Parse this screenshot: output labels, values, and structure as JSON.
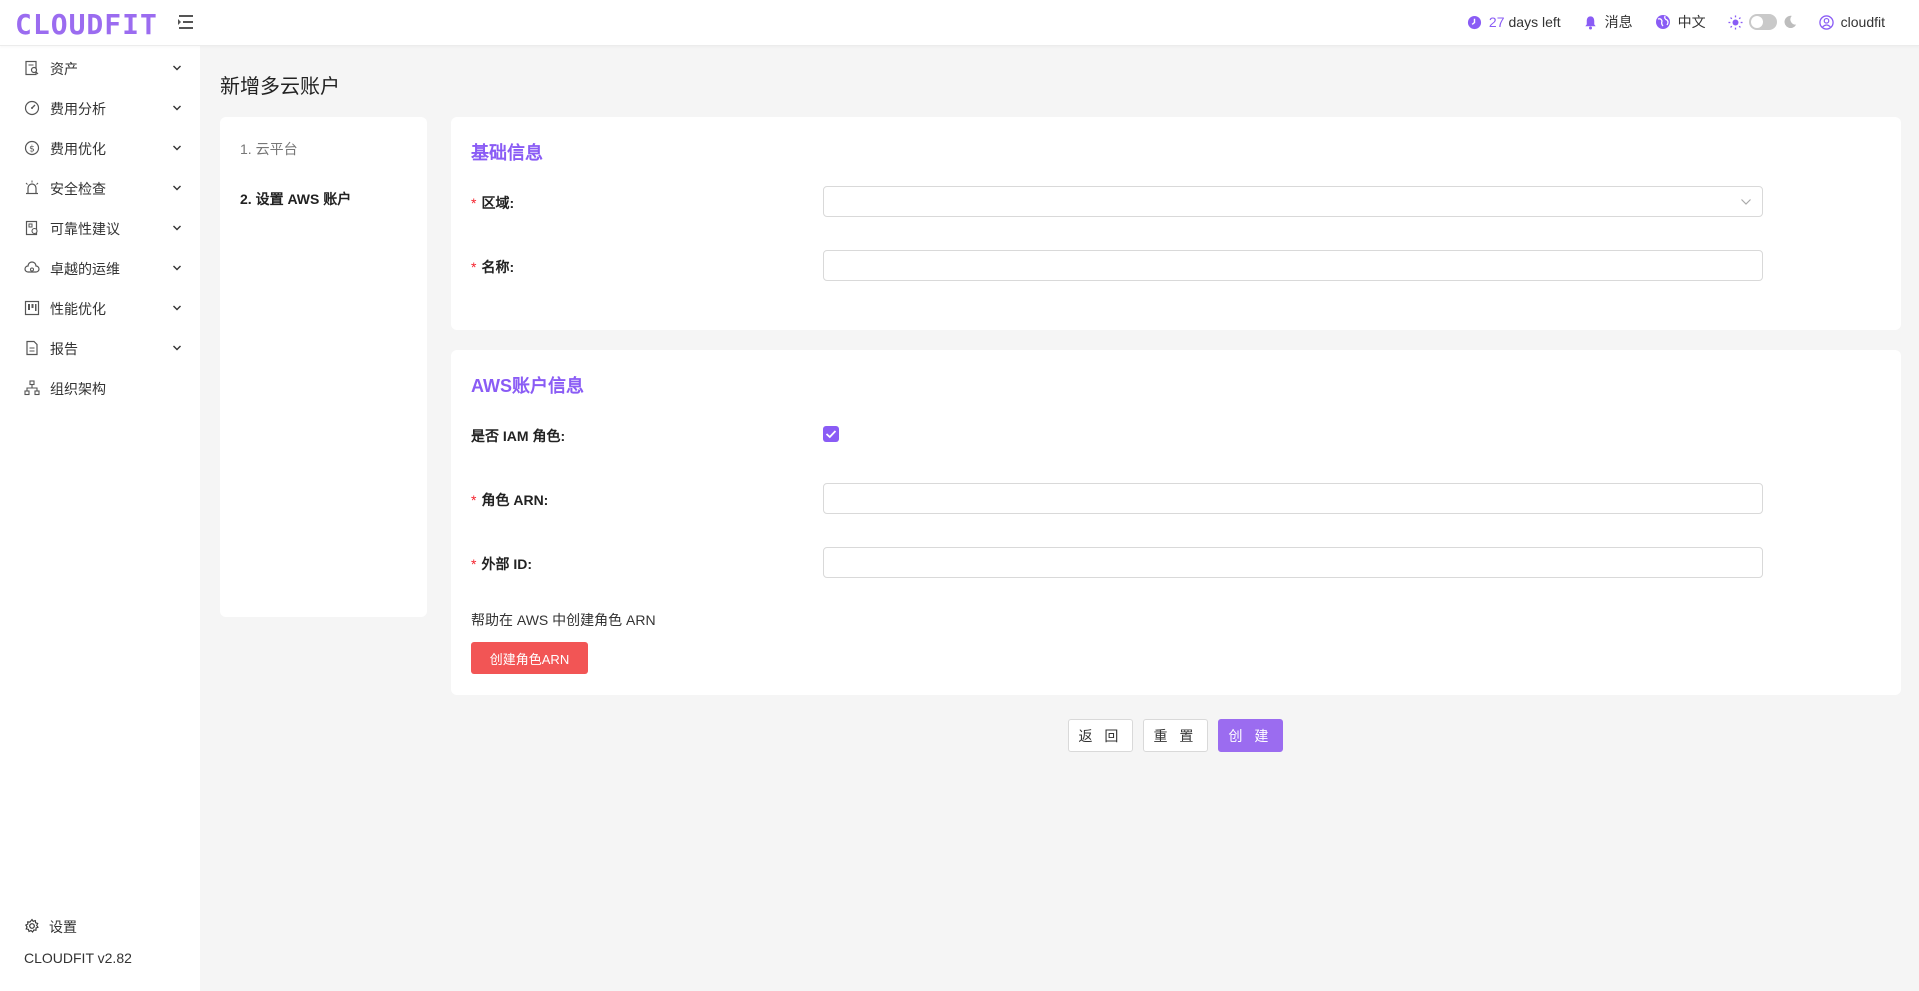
{
  "brand": {
    "logo": "CLOUDFIT",
    "accent_color": "#9b6cf0"
  },
  "header": {
    "trial_days": "27",
    "trial_suffix": "days left",
    "messages": "消息",
    "language": "中文",
    "username": "cloudfit"
  },
  "sidebar": {
    "items": [
      {
        "label": "资产",
        "icon": "asset-search-icon"
      },
      {
        "label": "费用分析",
        "icon": "dashboard-gauge-icon"
      },
      {
        "label": "费用优化",
        "icon": "dollar-circle-icon"
      },
      {
        "label": "安全检查",
        "icon": "alarm-light-icon"
      },
      {
        "label": "可靠性建议",
        "icon": "document-check-icon"
      },
      {
        "label": "卓越的运维",
        "icon": "cloud-sync-icon"
      },
      {
        "label": "性能优化",
        "icon": "board-icon"
      },
      {
        "label": "报告",
        "icon": "report-file-icon"
      },
      {
        "label": "组织架构",
        "icon": "org-chart-icon"
      }
    ],
    "settings": "设置",
    "version": "CLOUDFIT v2.82"
  },
  "page": {
    "title": "新增多云账户",
    "steps": [
      "1. 云平台",
      "2. 设置 AWS 账户"
    ]
  },
  "basic_info": {
    "title": "基础信息",
    "region_label": "区域:",
    "region_value": "",
    "name_label": "名称:",
    "name_value": ""
  },
  "aws_info": {
    "title": "AWS账户信息",
    "iam_role_label": "是否 IAM 角色:",
    "iam_role_checked": true,
    "role_arn_label": "角色 ARN:",
    "role_arn_value": "",
    "external_id_label": "外部 ID:",
    "external_id_value": "",
    "help_text": "帮助在 AWS 中创建角色 ARN",
    "create_arn_button": "创建角色ARN",
    "create_arn_color": "#f25555"
  },
  "actions": {
    "back": "返 回",
    "reset": "重 置",
    "create": "创 建"
  }
}
